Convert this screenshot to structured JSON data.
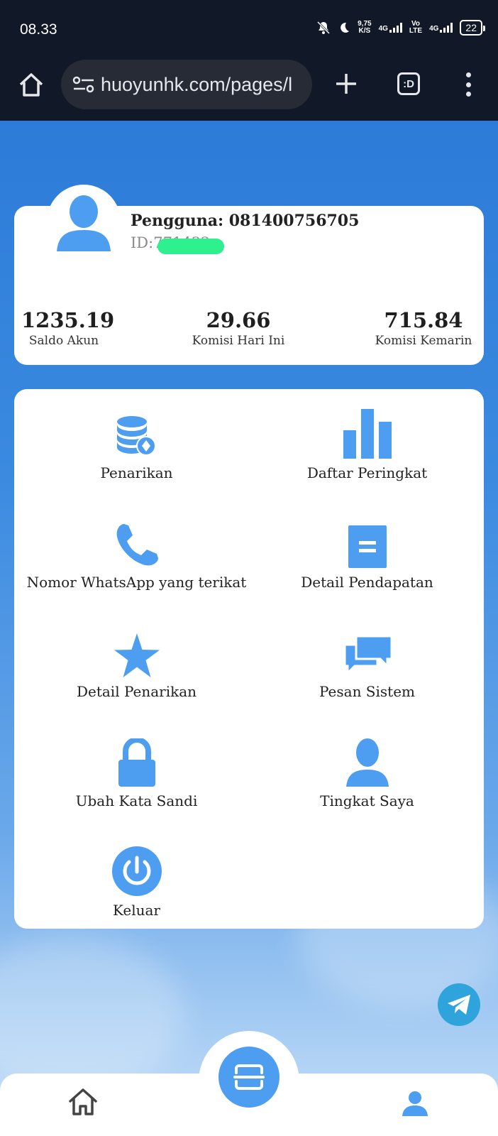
{
  "status_bar": {
    "time": "08.33",
    "net_speed": "9,75",
    "net_unit": "K/S",
    "sig1": "4G",
    "volte_top": "Vo",
    "volte_bottom": "LTE",
    "sig2": "4G",
    "battery": "22"
  },
  "browser": {
    "url": "huoyunhk.com/pages/l",
    "tabs_label": ":D"
  },
  "profile": {
    "username": "Pengguna: 081400756705",
    "id_label": "ID:",
    "id_value": "771432",
    "stats": [
      {
        "value": "1235.19",
        "label": "Saldo Akun"
      },
      {
        "value": "29.66",
        "label": "Komisi Hari Ini"
      },
      {
        "value": "715.84",
        "label": "Komisi Kemarin"
      }
    ]
  },
  "menu": {
    "items": [
      {
        "label": "Penarikan",
        "icon": "database-coin-icon"
      },
      {
        "label": "Daftar Peringkat",
        "icon": "bar-chart-icon"
      },
      {
        "label": "Nomor WhatsApp yang terikat",
        "icon": "phone-icon"
      },
      {
        "label": "Detail Pendapatan",
        "icon": "document-icon"
      },
      {
        "label": "Detail Penarikan",
        "icon": "star-icon"
      },
      {
        "label": "Pesan Sistem",
        "icon": "chat-bubbles-icon"
      },
      {
        "label": "Ubah Kata Sandi",
        "icon": "lock-icon"
      },
      {
        "label": "Tingkat Saya",
        "icon": "user-icon"
      },
      {
        "label": "Keluar",
        "icon": "power-icon"
      }
    ]
  },
  "colors": {
    "accent": "#4d9ef0",
    "background": "#2e7fd8",
    "card": "#ffffff"
  }
}
